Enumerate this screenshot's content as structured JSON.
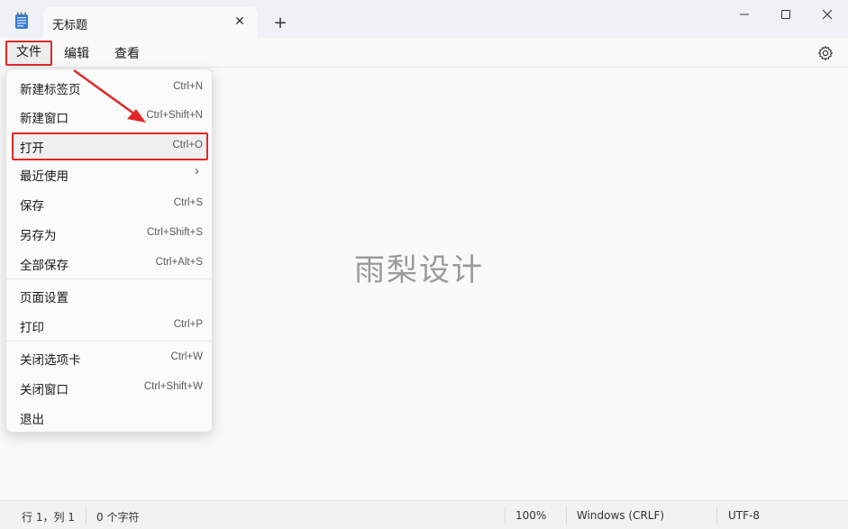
{
  "window": {
    "tab_title": "无标题",
    "tab_close": "✕",
    "new_tab": "+"
  },
  "menubar": {
    "file": "文件",
    "edit": "编辑",
    "view": "查看"
  },
  "file_menu": {
    "items": [
      {
        "label": "新建标签页",
        "shortcut": "Ctrl+N"
      },
      {
        "label": "新建窗口",
        "shortcut": "Ctrl+Shift+N"
      },
      {
        "label": "打开",
        "shortcut": "Ctrl+O"
      },
      {
        "label": "最近使用",
        "shortcut": "›"
      },
      {
        "label": "保存",
        "shortcut": "Ctrl+S"
      },
      {
        "label": "另存为",
        "shortcut": "Ctrl+Shift+S"
      },
      {
        "label": "全部保存",
        "shortcut": "Ctrl+Alt+S"
      },
      {
        "label": "页面设置",
        "shortcut": ""
      },
      {
        "label": "打印",
        "shortcut": "Ctrl+P"
      },
      {
        "label": "关闭选项卡",
        "shortcut": "Ctrl+W"
      },
      {
        "label": "关闭窗口",
        "shortcut": "Ctrl+Shift+W"
      },
      {
        "label": "退出",
        "shortcut": ""
      }
    ]
  },
  "watermark": "雨梨设计",
  "statusbar": {
    "position": "行 1，列 1",
    "chars": "0 个字符",
    "zoom": "100%",
    "line_ending": "Windows (CRLF)",
    "encoding": "UTF-8"
  },
  "colors": {
    "annotation_red": "#e02828"
  }
}
